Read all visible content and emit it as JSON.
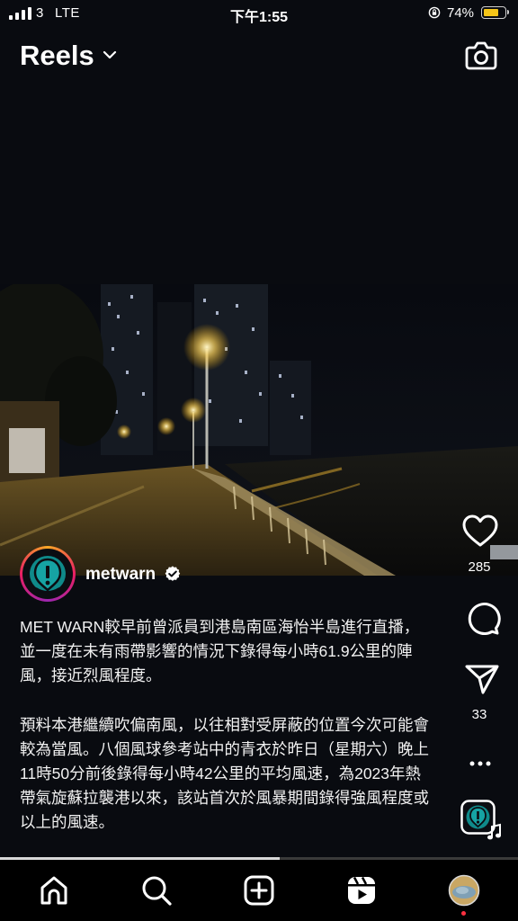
{
  "status_bar": {
    "carrier": "3",
    "network": "LTE",
    "time": "下午1:55",
    "battery_percent": "74%",
    "battery_level": 0.74
  },
  "header": {
    "title": "Reels",
    "title_icon": "chevron-down-icon",
    "camera_icon": "camera-icon"
  },
  "reel": {
    "username": "metwarn",
    "verified_icon": "verified-badge-icon",
    "caption_paragraphs": [
      "MET WARN較早前曾派員到港島南區海怡半島進行直播，並一度在未有雨帶影響的情況下錄得每小時61.9公里的陣風，接近烈風程度。",
      "預料本港繼續吹偏南風，以往相對受屏蔽的位置今次可能會較為當風。八個風球參考站中的青衣於昨日（星期六）晚上11時50分前後錄得每小時42公里的平均風速，為2023年熱帶氣旋蘇拉襲港以來，該站首次於風暴期間錄得強風程度或以上的風速。"
    ],
    "likes": "285",
    "shares": "33",
    "progress": 0.54
  },
  "actions": {
    "like_icon": "heart-icon",
    "comment_icon": "comment-icon",
    "share_icon": "send-icon",
    "more_icon": "more-dots-icon",
    "audio_icon": "audio-thumbnail-icon"
  },
  "tabs": [
    "home-icon",
    "search-icon",
    "create-icon",
    "reels-icon",
    "profile-icon"
  ],
  "colors": {
    "background": "#090b10",
    "story_ring_start": "#f9a825",
    "story_ring_end": "#e91e63",
    "battery": "#f5c518",
    "notification_dot": "#ff3040",
    "avatar_teal": "#0f8a8a"
  }
}
